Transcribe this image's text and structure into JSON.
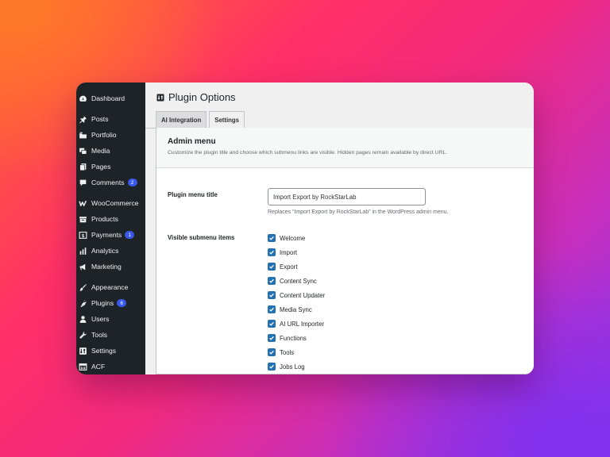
{
  "sidebar": {
    "items": [
      {
        "label": "Dashboard",
        "icon": "dashboard-icon",
        "badge": ""
      },
      {
        "label": "Posts",
        "icon": "pin-icon",
        "badge": ""
      },
      {
        "label": "Portfolio",
        "icon": "portfolio-icon",
        "badge": ""
      },
      {
        "label": "Media",
        "icon": "media-icon",
        "badge": ""
      },
      {
        "label": "Pages",
        "icon": "pages-icon",
        "badge": ""
      },
      {
        "label": "Comments",
        "icon": "comment-icon",
        "badge": "2"
      },
      {
        "label": "WooCommerce",
        "icon": "woocommerce-icon",
        "badge": ""
      },
      {
        "label": "Products",
        "icon": "products-icon",
        "badge": ""
      },
      {
        "label": "Payments",
        "icon": "payments-icon",
        "badge": "1"
      },
      {
        "label": "Analytics",
        "icon": "analytics-icon",
        "badge": ""
      },
      {
        "label": "Marketing",
        "icon": "megaphone-icon",
        "badge": ""
      },
      {
        "label": "Appearance",
        "icon": "brush-icon",
        "badge": ""
      },
      {
        "label": "Plugins",
        "icon": "plugin-icon",
        "badge": "6"
      },
      {
        "label": "Users",
        "icon": "user-icon",
        "badge": ""
      },
      {
        "label": "Tools",
        "icon": "wrench-icon",
        "badge": ""
      },
      {
        "label": "Settings",
        "icon": "settings-icon",
        "badge": ""
      },
      {
        "label": "ACF",
        "icon": "acf-icon",
        "badge": ""
      }
    ]
  },
  "page": {
    "title": "Plugin Options",
    "tabs": [
      {
        "label": "AI Integration",
        "active": false
      },
      {
        "label": "Settings",
        "active": true
      }
    ]
  },
  "section": {
    "title": "Admin menu",
    "description": "Customize the plugin title and choose which submenu links are visible. Hidden pages remain available by direct URL."
  },
  "menu_title_field": {
    "label": "Plugin menu title",
    "value": "Import Export by RockStarLab",
    "hint": "Replaces “Import Export by RockStarLab” in the WordPress admin menu."
  },
  "submenu": {
    "label": "Visible submenu items",
    "items": [
      {
        "label": "Welcome",
        "checked": true
      },
      {
        "label": "Import",
        "checked": true
      },
      {
        "label": "Export",
        "checked": true
      },
      {
        "label": "Content Sync",
        "checked": true
      },
      {
        "label": "Content Updater",
        "checked": true
      },
      {
        "label": "Media Sync",
        "checked": true
      },
      {
        "label": "AI URL Importer",
        "checked": true
      },
      {
        "label": "Functions",
        "checked": true
      },
      {
        "label": "Tools",
        "checked": true
      },
      {
        "label": "Jobs Log",
        "checked": true
      }
    ]
  },
  "colors": {
    "sidebar_bg": "#1d2327",
    "badge": "#3858e9",
    "checkbox": "#2271b1"
  }
}
